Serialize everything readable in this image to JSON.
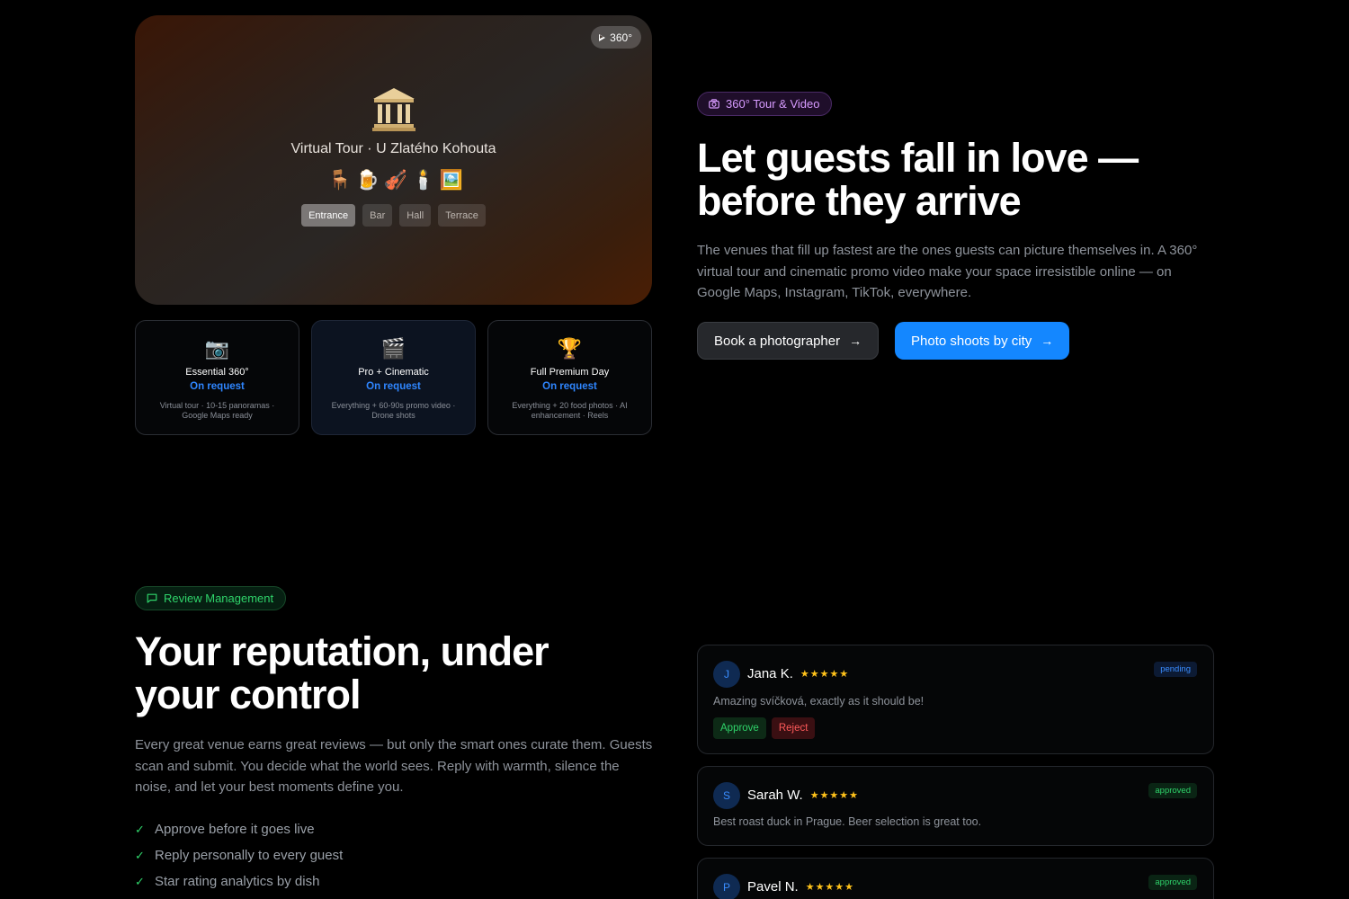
{
  "tour": {
    "badge": "360°",
    "title": "Virtual Tour · U Zlatého Kohouta",
    "emojis": [
      "🪑",
      "🍺",
      "🎻",
      "🕯️",
      "🖼️"
    ],
    "rooms": [
      "Entrance",
      "Bar",
      "Hall",
      "Terrace"
    ],
    "active_room": "Entrance"
  },
  "packages": [
    {
      "icon": "📷",
      "name": "Essential 360°",
      "price": "On request",
      "desc": "Virtual tour · 10-15 panoramas · Google Maps ready"
    },
    {
      "icon": "🎬",
      "name": "Pro + Cinematic",
      "price": "On request",
      "desc": "Everything + 60-90s promo video · Drone shots"
    },
    {
      "icon": "🏆",
      "name": "Full Premium Day",
      "price": "On request",
      "desc": "Everything + 20 food photos · AI enhancement · Reels"
    }
  ],
  "tour_section": {
    "pill": "360° Tour & Video",
    "heading": "Let guests fall in love — before they arrive",
    "lead": "The venues that fill up fastest are the ones guests can picture themselves in. A 360° virtual tour and cinematic promo video make your space irresistible online — on Google Maps, Instagram, TikTok, everywhere.",
    "btn_primary": "Book a photographer",
    "btn_secondary": "Photo shoots by city"
  },
  "review_section": {
    "pill": "Review Management",
    "heading": "Your reputation, under your control",
    "lead": "Every great venue earns great reviews — but only the smart ones curate them. Guests scan and submit. You decide what the world sees. Reply with warmth, silence the noise, and let your best moments define you.",
    "checks": [
      "Approve before it goes live",
      "Reply personally to every guest",
      "Star rating analytics by dish"
    ]
  },
  "reviews": [
    {
      "initial": "J",
      "name": "Jana K.",
      "stars": "★★★★★",
      "rating": 5,
      "status": "pending",
      "text": "Amazing svíčková, exactly as it should be!",
      "approve": "Approve",
      "reject": "Reject"
    },
    {
      "initial": "S",
      "name": "Sarah W.",
      "stars": "★★★★★",
      "rating": 5,
      "status": "approved",
      "text": "Best roast duck in Prague. Beer selection is great too."
    },
    {
      "initial": "P",
      "name": "Pavel N.",
      "stars": "★★★★★",
      "rating": 5,
      "status": "approved",
      "text": ""
    }
  ],
  "colors": {
    "accent_blue": "#1487ff",
    "accent_green": "#2fd36a",
    "accent_purple": "#d79bff",
    "star": "#ffc21a"
  }
}
